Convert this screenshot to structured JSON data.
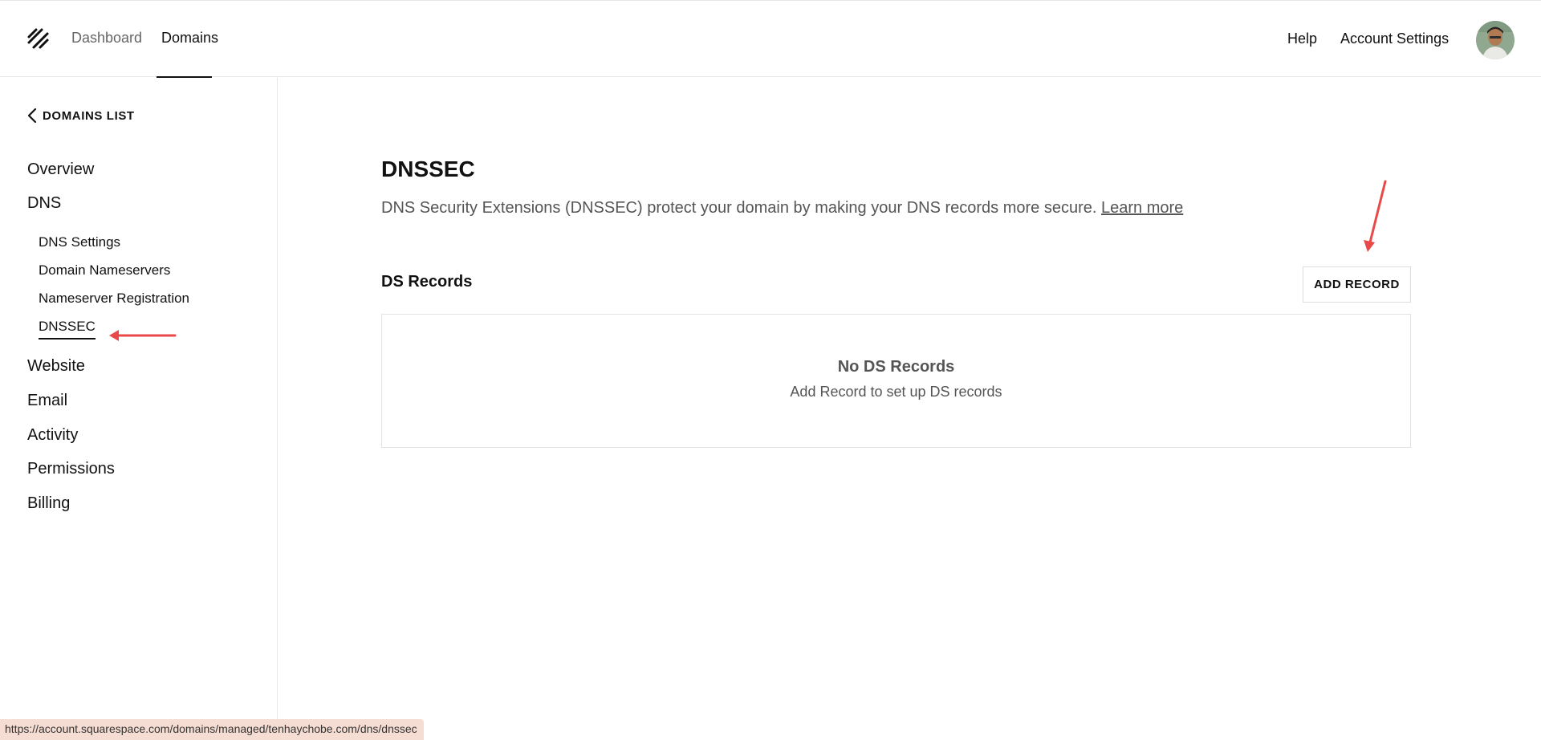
{
  "header": {
    "nav": [
      {
        "label": "Dashboard",
        "active": false
      },
      {
        "label": "Domains",
        "active": true
      }
    ],
    "right_links": {
      "help": "Help",
      "account_settings": "Account Settings"
    }
  },
  "sidebar": {
    "back_label": "DOMAINS LIST",
    "items": {
      "overview": "Overview",
      "dns": "DNS",
      "website": "Website",
      "email": "Email",
      "activity": "Activity",
      "permissions": "Permissions",
      "billing": "Billing"
    },
    "dns_sub_items": {
      "dns_settings": "DNS Settings",
      "domain_nameservers": "Domain Nameservers",
      "nameserver_registration": "Nameserver Registration",
      "dnssec": "DNSSEC"
    },
    "active_item": "DNSSEC"
  },
  "main": {
    "title": "DNSSEC",
    "description": "DNS Security Extensions (DNSSEC) protect your domain by making your DNS records more secure.",
    "learn_more": "Learn more",
    "section_title": "DS Records",
    "add_record_label": "ADD RECORD",
    "empty_title": "No DS Records",
    "empty_subtitle": "Add Record to set up DS records"
  },
  "status_bar": {
    "url": "https://account.squarespace.com/domains/managed/tenhaychobe.com/dns/dnssec"
  },
  "colors": {
    "text_primary": "#111111",
    "text_secondary": "#555555",
    "border": "#e6e6e6",
    "annotation_arrow": "#e84a4a",
    "status_bar_bg": "#f6ddd3"
  }
}
